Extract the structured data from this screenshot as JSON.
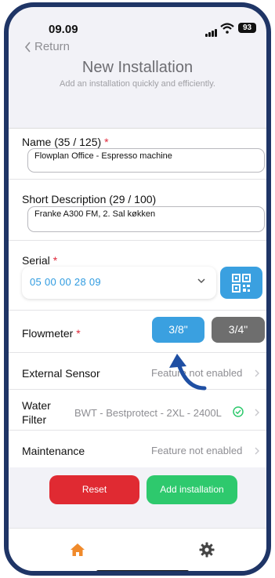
{
  "status": {
    "time": "09.09",
    "battery": "93"
  },
  "nav": {
    "back_label": "Return"
  },
  "header": {
    "title": "New Installation",
    "subtitle": "Add an installation quickly and efficiently."
  },
  "form": {
    "name": {
      "label": "Name (35 / 125)",
      "required_mark": "*",
      "value": "Flowplan Office -  Espresso machine"
    },
    "short_description": {
      "label": "Short Description (29 / 100)",
      "value": "Franke A300 FM, 2. Sal køkken"
    },
    "serial": {
      "label": "Serial",
      "required_mark": "*",
      "value": "05 00 00 28 09"
    },
    "flowmeter": {
      "label": "Flowmeter",
      "required_mark": "*",
      "options": [
        "3/8\"",
        "3/4\""
      ],
      "selected": "3/8\""
    },
    "external_sensor": {
      "label": "External Sensor",
      "value": "Feature not enabled"
    },
    "water_filter": {
      "label": "Water Filter",
      "value": "BWT - Bestprotect - 2XL - 2400L"
    },
    "maintenance": {
      "label": "Maintenance",
      "value": "Feature not enabled"
    }
  },
  "actions": {
    "reset_label": "Reset",
    "add_label": "Add installation"
  },
  "tabs": {
    "home_icon": "home-icon",
    "settings_icon": "gear-icon"
  },
  "colors": {
    "accent": "#3aa0e0",
    "reset": "#e02a32",
    "add": "#2ec96d",
    "inactive_option": "#6e6e6e",
    "frame": "#1f3566",
    "tab_active": "#f08a2b"
  }
}
